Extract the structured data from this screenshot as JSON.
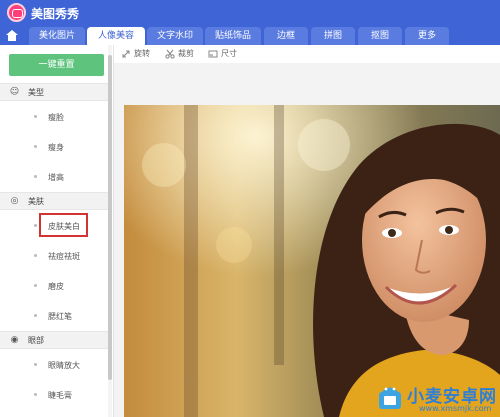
{
  "app": {
    "title": "美图秀秀"
  },
  "tabs": [
    {
      "label": "美化图片",
      "active": false
    },
    {
      "label": "人像美容",
      "active": true
    },
    {
      "label": "文字水印",
      "active": false
    },
    {
      "label": "贴纸饰品",
      "active": false
    },
    {
      "label": "边框",
      "active": false
    },
    {
      "label": "拼图",
      "active": false
    },
    {
      "label": "抠图",
      "active": false
    },
    {
      "label": "更多",
      "active": false
    }
  ],
  "sidebar": {
    "reset_label": "一键重置",
    "sections": [
      {
        "label": "美型",
        "icon": "smile-face-icon",
        "items": [
          "瘦脸",
          "瘦身",
          "增高"
        ]
      },
      {
        "label": "美肤",
        "icon": "skin-icon",
        "items": [
          "皮肤美白",
          "祛痘祛斑",
          "磨皮",
          "腮红笔"
        ]
      },
      {
        "label": "眼部",
        "icon": "eye-icon",
        "items": [
          "眼睛放大",
          "睫毛膏"
        ]
      }
    ],
    "selected_item": "皮肤美白"
  },
  "toolbar": {
    "rotate_label": "旋转",
    "crop_label": "裁剪",
    "size_label": "尺寸"
  },
  "watermark": {
    "title": "小麦安卓网",
    "url": "www.xmsmjk.com"
  },
  "colors": {
    "header": "#3f64d6",
    "accent_green": "#5ec47d",
    "highlight_red": "#d23333"
  }
}
